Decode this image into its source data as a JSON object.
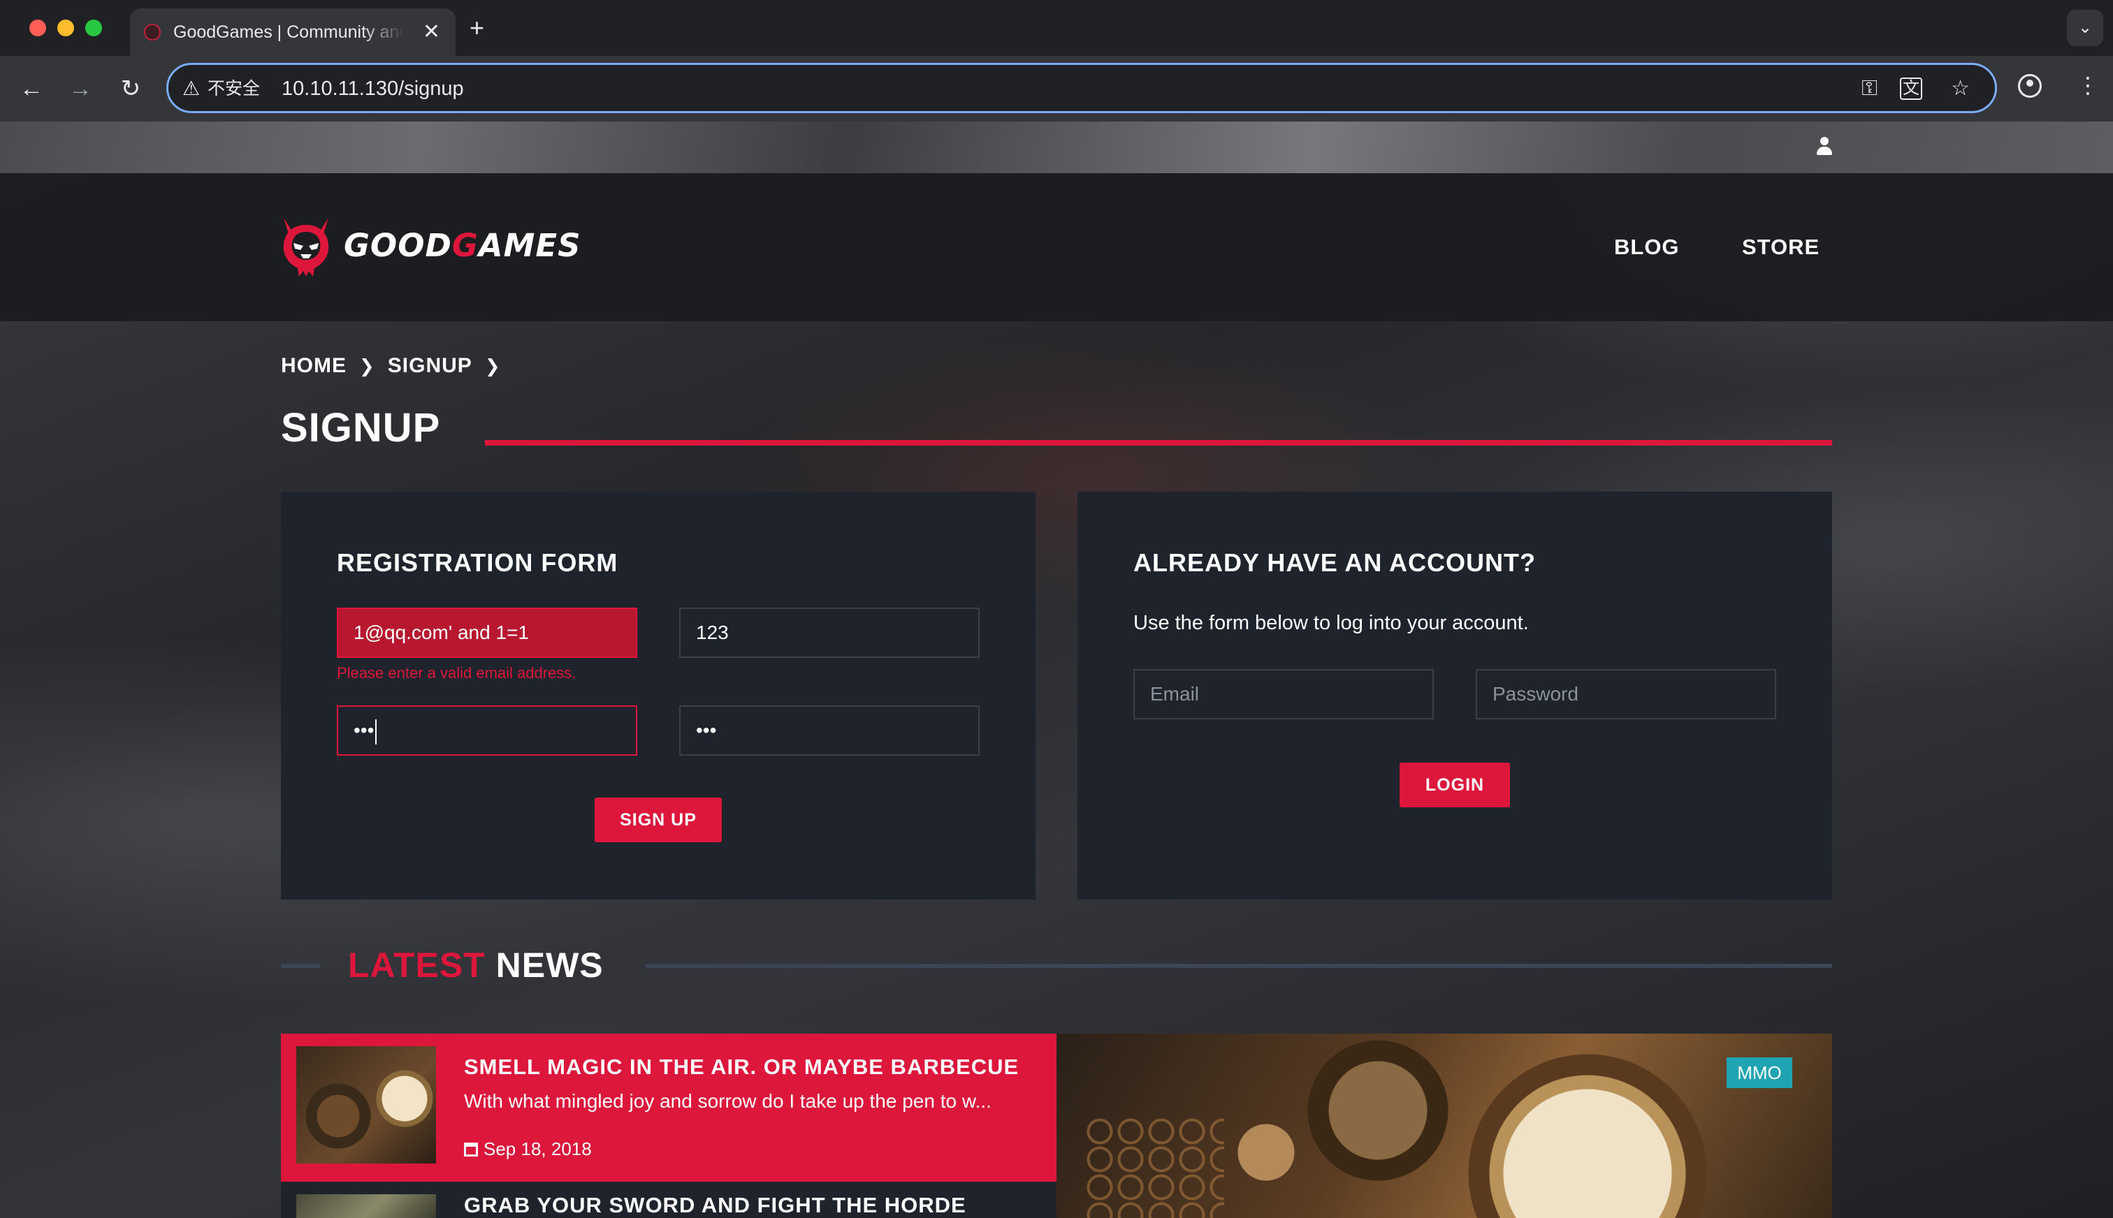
{
  "browser": {
    "tab_title": "GoodGames | Community and Store",
    "tab_close": "✕",
    "new_tab": "+",
    "tab_menu": "⌄",
    "security_label": "不安全",
    "url": "10.10.11.130/signup",
    "icons": [
      "back-arrow-icon",
      "forward-arrow-icon",
      "reload-icon",
      "warning-icon",
      "key-icon",
      "translate-icon",
      "star-icon",
      "profile-icon",
      "kebab-menu-icon"
    ]
  },
  "site": {
    "logo_text_a": "GOOD",
    "logo_text_b": "G",
    "logo_text_c": "AMES",
    "nav": [
      "BLOG",
      "STORE"
    ],
    "accent_color": "#dd163b"
  },
  "breadcrumb": [
    "HOME",
    "SIGNUP"
  ],
  "page_title": "SIGNUP",
  "registration": {
    "heading": "REGISTRATION FORM",
    "email_value": "1@qq.com' and 1=1",
    "name_value": "123",
    "email_error": "Please enter a valid email address.",
    "password_value": "•••",
    "confirm_value": "•••",
    "submit_label": "SIGN UP"
  },
  "login": {
    "heading": "ALREADY HAVE AN ACCOUNT?",
    "subtext": "Use the form below to log into your account.",
    "email_placeholder": "Email",
    "password_placeholder": "Password",
    "submit_label": "LOGIN"
  },
  "news": {
    "title_accent": "LATEST",
    "title_rest": "NEWS",
    "items": [
      {
        "title": "SMELL MAGIC IN THE AIR. OR MAYBE BARBECUE",
        "excerpt": "With what mingled joy and sorrow do I take up the pen to w...",
        "date": "Sep 18, 2018"
      },
      {
        "title": "GRAB YOUR SWORD AND FIGHT THE HORDE"
      }
    ],
    "feature_badge": "MMO",
    "badge_color": "#1fa4b4"
  }
}
